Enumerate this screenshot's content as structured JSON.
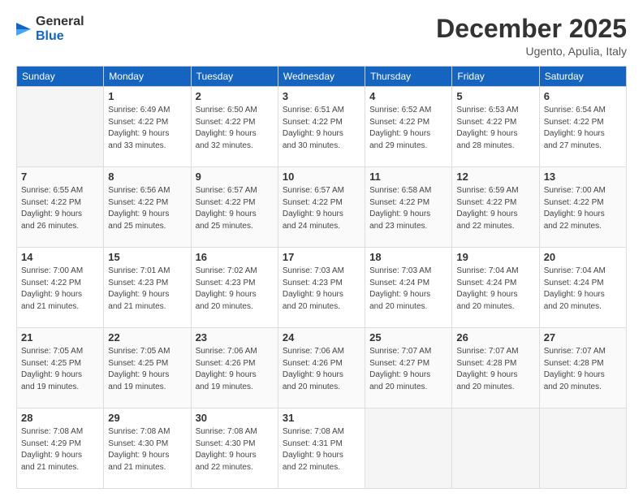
{
  "header": {
    "logo_line1": "General",
    "logo_line2": "Blue",
    "month": "December 2025",
    "location": "Ugento, Apulia, Italy"
  },
  "days_of_week": [
    "Sunday",
    "Monday",
    "Tuesday",
    "Wednesday",
    "Thursday",
    "Friday",
    "Saturday"
  ],
  "weeks": [
    [
      {
        "day": "",
        "info": ""
      },
      {
        "day": "1",
        "info": "Sunrise: 6:49 AM\nSunset: 4:22 PM\nDaylight: 9 hours\nand 33 minutes."
      },
      {
        "day": "2",
        "info": "Sunrise: 6:50 AM\nSunset: 4:22 PM\nDaylight: 9 hours\nand 32 minutes."
      },
      {
        "day": "3",
        "info": "Sunrise: 6:51 AM\nSunset: 4:22 PM\nDaylight: 9 hours\nand 30 minutes."
      },
      {
        "day": "4",
        "info": "Sunrise: 6:52 AM\nSunset: 4:22 PM\nDaylight: 9 hours\nand 29 minutes."
      },
      {
        "day": "5",
        "info": "Sunrise: 6:53 AM\nSunset: 4:22 PM\nDaylight: 9 hours\nand 28 minutes."
      },
      {
        "day": "6",
        "info": "Sunrise: 6:54 AM\nSunset: 4:22 PM\nDaylight: 9 hours\nand 27 minutes."
      }
    ],
    [
      {
        "day": "7",
        "info": "Sunrise: 6:55 AM\nSunset: 4:22 PM\nDaylight: 9 hours\nand 26 minutes."
      },
      {
        "day": "8",
        "info": "Sunrise: 6:56 AM\nSunset: 4:22 PM\nDaylight: 9 hours\nand 25 minutes."
      },
      {
        "day": "9",
        "info": "Sunrise: 6:57 AM\nSunset: 4:22 PM\nDaylight: 9 hours\nand 25 minutes."
      },
      {
        "day": "10",
        "info": "Sunrise: 6:57 AM\nSunset: 4:22 PM\nDaylight: 9 hours\nand 24 minutes."
      },
      {
        "day": "11",
        "info": "Sunrise: 6:58 AM\nSunset: 4:22 PM\nDaylight: 9 hours\nand 23 minutes."
      },
      {
        "day": "12",
        "info": "Sunrise: 6:59 AM\nSunset: 4:22 PM\nDaylight: 9 hours\nand 22 minutes."
      },
      {
        "day": "13",
        "info": "Sunrise: 7:00 AM\nSunset: 4:22 PM\nDaylight: 9 hours\nand 22 minutes."
      }
    ],
    [
      {
        "day": "14",
        "info": "Sunrise: 7:00 AM\nSunset: 4:22 PM\nDaylight: 9 hours\nand 21 minutes."
      },
      {
        "day": "15",
        "info": "Sunrise: 7:01 AM\nSunset: 4:23 PM\nDaylight: 9 hours\nand 21 minutes."
      },
      {
        "day": "16",
        "info": "Sunrise: 7:02 AM\nSunset: 4:23 PM\nDaylight: 9 hours\nand 20 minutes."
      },
      {
        "day": "17",
        "info": "Sunrise: 7:03 AM\nSunset: 4:23 PM\nDaylight: 9 hours\nand 20 minutes."
      },
      {
        "day": "18",
        "info": "Sunrise: 7:03 AM\nSunset: 4:24 PM\nDaylight: 9 hours\nand 20 minutes."
      },
      {
        "day": "19",
        "info": "Sunrise: 7:04 AM\nSunset: 4:24 PM\nDaylight: 9 hours\nand 20 minutes."
      },
      {
        "day": "20",
        "info": "Sunrise: 7:04 AM\nSunset: 4:24 PM\nDaylight: 9 hours\nand 20 minutes."
      }
    ],
    [
      {
        "day": "21",
        "info": "Sunrise: 7:05 AM\nSunset: 4:25 PM\nDaylight: 9 hours\nand 19 minutes."
      },
      {
        "day": "22",
        "info": "Sunrise: 7:05 AM\nSunset: 4:25 PM\nDaylight: 9 hours\nand 19 minutes."
      },
      {
        "day": "23",
        "info": "Sunrise: 7:06 AM\nSunset: 4:26 PM\nDaylight: 9 hours\nand 19 minutes."
      },
      {
        "day": "24",
        "info": "Sunrise: 7:06 AM\nSunset: 4:26 PM\nDaylight: 9 hours\nand 20 minutes."
      },
      {
        "day": "25",
        "info": "Sunrise: 7:07 AM\nSunset: 4:27 PM\nDaylight: 9 hours\nand 20 minutes."
      },
      {
        "day": "26",
        "info": "Sunrise: 7:07 AM\nSunset: 4:28 PM\nDaylight: 9 hours\nand 20 minutes."
      },
      {
        "day": "27",
        "info": "Sunrise: 7:07 AM\nSunset: 4:28 PM\nDaylight: 9 hours\nand 20 minutes."
      }
    ],
    [
      {
        "day": "28",
        "info": "Sunrise: 7:08 AM\nSunset: 4:29 PM\nDaylight: 9 hours\nand 21 minutes."
      },
      {
        "day": "29",
        "info": "Sunrise: 7:08 AM\nSunset: 4:30 PM\nDaylight: 9 hours\nand 21 minutes."
      },
      {
        "day": "30",
        "info": "Sunrise: 7:08 AM\nSunset: 4:30 PM\nDaylight: 9 hours\nand 22 minutes."
      },
      {
        "day": "31",
        "info": "Sunrise: 7:08 AM\nSunset: 4:31 PM\nDaylight: 9 hours\nand 22 minutes."
      },
      {
        "day": "",
        "info": ""
      },
      {
        "day": "",
        "info": ""
      },
      {
        "day": "",
        "info": ""
      }
    ]
  ]
}
